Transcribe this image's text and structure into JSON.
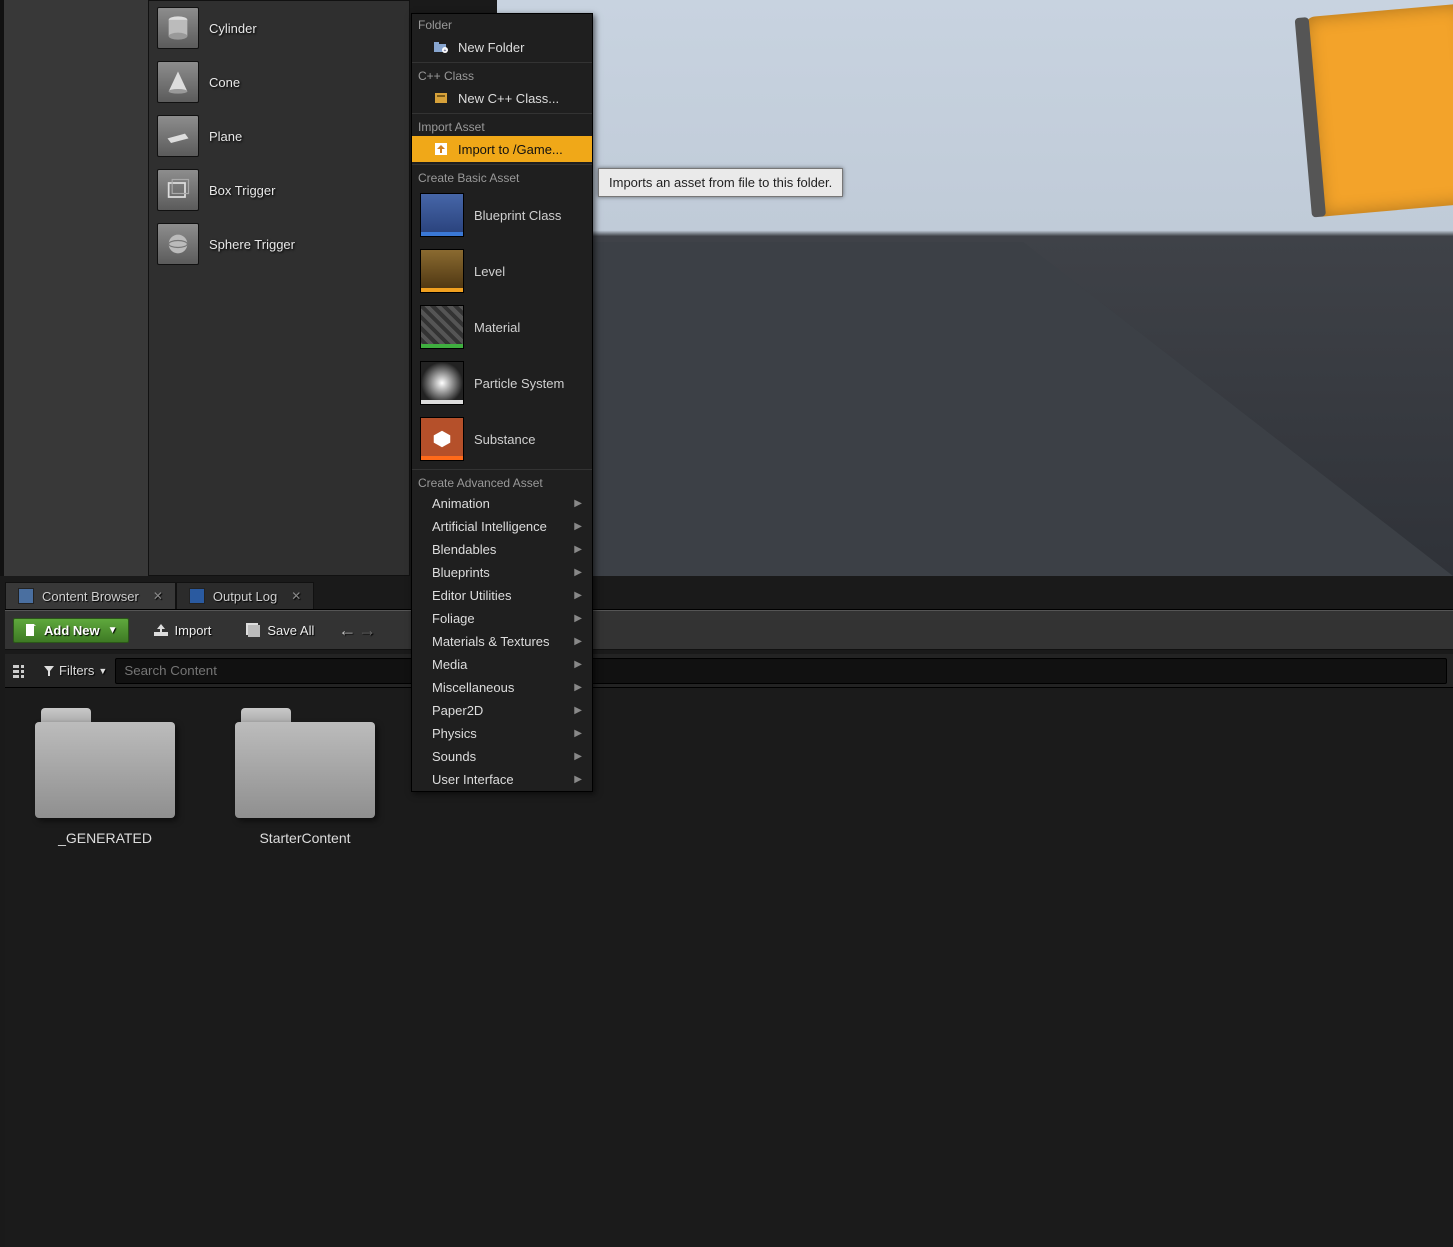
{
  "place_actors": {
    "items": [
      {
        "label": "Cylinder",
        "shape": "cylinder"
      },
      {
        "label": "Cone",
        "shape": "cone"
      },
      {
        "label": "Plane",
        "shape": "plane"
      },
      {
        "label": "Box Trigger",
        "shape": "box"
      },
      {
        "label": "Sphere Trigger",
        "shape": "sphere"
      }
    ]
  },
  "contextmenu": {
    "folder_header": "Folder",
    "new_folder": "New Folder",
    "cpp_header": "C++ Class",
    "new_cpp": "New C++ Class...",
    "import_header": "Import Asset",
    "import_label": "Import to /Game...",
    "basic_header": "Create Basic Asset",
    "basic_assets": [
      {
        "label": "Blueprint Class",
        "accent": "#3a78d6",
        "bg": "#3256a0"
      },
      {
        "label": "Level",
        "accent": "#f0a020",
        "bg": "#6a5020"
      },
      {
        "label": "Material",
        "accent": "#3fae3f",
        "bg": "#3a3a3a"
      },
      {
        "label": "Particle System",
        "accent": "#dddddd",
        "bg": "#222"
      },
      {
        "label": "Substance",
        "accent": "#ff6a1a",
        "bg": "#a04418"
      }
    ],
    "advanced_header": "Create Advanced Asset",
    "advanced": [
      "Animation",
      "Artificial Intelligence",
      "Blendables",
      "Blueprints",
      "Editor Utilities",
      "Foliage",
      "Materials & Textures",
      "Media",
      "Miscellaneous",
      "Paper2D",
      "Physics",
      "Sounds",
      "User Interface"
    ]
  },
  "tooltip": "Imports an asset from file to this folder.",
  "tabs": {
    "content_browser": "Content Browser",
    "output_log": "Output Log"
  },
  "toolbar": {
    "add_new": "Add New",
    "import": "Import",
    "save_all": "Save All"
  },
  "filterbar": {
    "filters_label": "Filters",
    "search_placeholder": "Search Content"
  },
  "folders": [
    {
      "label": "_GENERATED"
    },
    {
      "label": "StarterContent"
    }
  ]
}
